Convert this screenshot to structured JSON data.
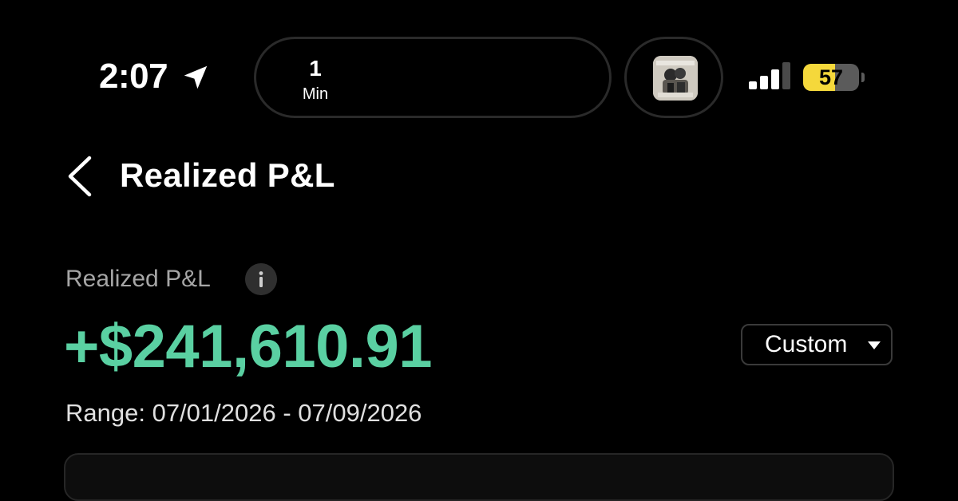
{
  "status_bar": {
    "time": "2:07",
    "location_icon": "location-arrow-icon",
    "timer": {
      "value": "1",
      "unit": "Min"
    },
    "album_icon": "album-art-thumbnail",
    "signal_icon": "cellular-signal-icon",
    "signal_bars_active": 3,
    "signal_bars_total": 4,
    "battery": {
      "level_text": "57",
      "level_fraction": 0.57,
      "color": "#f5d83b"
    }
  },
  "header": {
    "back_icon": "chevron-left-icon",
    "title": "Realized P&L"
  },
  "summary": {
    "label": "Realized P&L",
    "info_icon": "info-icon",
    "value": "+$241,610.91",
    "value_color": "#5ad0a2",
    "range_selector": {
      "label": "Custom",
      "icon": "caret-down-icon"
    },
    "range_text": "Range: 07/01/2026 - 07/09/2026"
  }
}
